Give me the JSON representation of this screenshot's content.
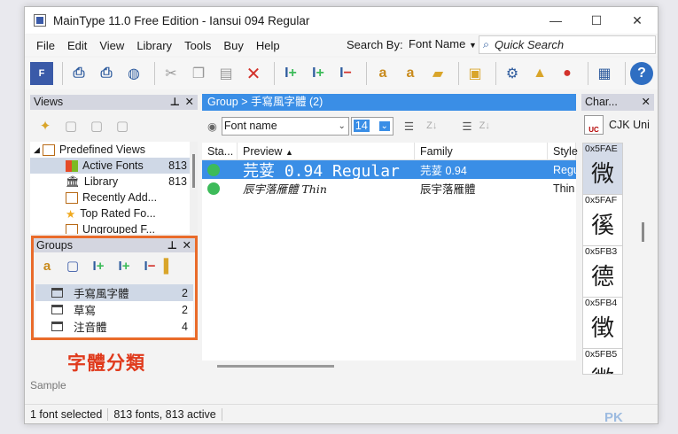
{
  "window": {
    "title": "MainType 11.0 Free Edition - Iansui 094 Regular",
    "min": "—",
    "max": "☐",
    "close": "✕"
  },
  "menu": [
    "File",
    "Edit",
    "View",
    "Library",
    "Tools",
    "Buy",
    "Help"
  ],
  "search": {
    "by_label": "Search By:",
    "by_value": "Font Name",
    "quick_placeholder": "Quick Search"
  },
  "views": {
    "title": "Views",
    "items": [
      {
        "label": "Predefined Views",
        "count": ""
      },
      {
        "label": "Active Fonts",
        "count": "813"
      },
      {
        "label": "Library",
        "count": "813"
      },
      {
        "label": "Recently Add...",
        "count": ""
      },
      {
        "label": "Top Rated Fo...",
        "count": ""
      },
      {
        "label": "Ungrouped F...",
        "count": ""
      }
    ]
  },
  "groups": {
    "title": "Groups",
    "items": [
      {
        "label": "手寫風字體",
        "count": "2"
      },
      {
        "label": "草寫",
        "count": "2"
      },
      {
        "label": "注音體",
        "count": "4"
      }
    ]
  },
  "caption": "字體分類",
  "sample_label": "Sample",
  "status": {
    "selected": "1 font selected",
    "fonts": "813 fonts, 813 active"
  },
  "font_panel": {
    "breadcrumb": "Group > 手寫風字體 (2)",
    "field_select": "Font name",
    "size": "14",
    "columns": [
      "Sta...",
      "Preview",
      "Family",
      "Style"
    ],
    "rows": [
      {
        "preview": "芫荽 0.94 Regular",
        "family": "芫荽 0.94",
        "style": "Regu"
      },
      {
        "preview": "辰宇落雁體 Thin",
        "family": "辰宇落雁體",
        "style": "Thin"
      }
    ]
  },
  "char_panel": {
    "title": "Char...",
    "charset": "CJK Uni",
    "cells": [
      {
        "code": "0x5FAE",
        "glyph": "微"
      },
      {
        "code": "0x5FAF",
        "glyph": "徯"
      },
      {
        "code": "0x5FB3",
        "glyph": "德"
      },
      {
        "code": "0x5FB4",
        "glyph": "徴"
      },
      {
        "code": "0x5FB5",
        "glyph": "徵"
      }
    ]
  },
  "watermark": "PK"
}
